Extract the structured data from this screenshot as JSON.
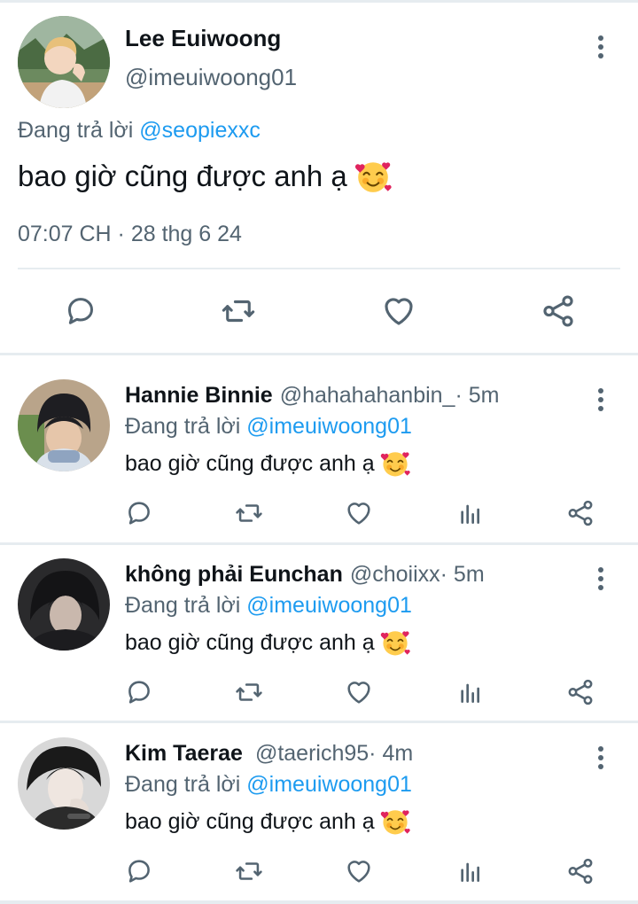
{
  "main_tweet": {
    "author_name": "Lee Euiwoong",
    "author_handle": "@imeuiwoong01",
    "reply_prefix": "Đang trả lời",
    "reply_to": "@seopiexxc",
    "text": "bao giờ cũng được anh ạ",
    "emoji": "smiling-face-with-hearts",
    "timestamp": "07:07 CH · 28 thg 6 24",
    "actions": [
      "reply-icon",
      "retweet-icon",
      "like-icon",
      "share-icon"
    ]
  },
  "replies": [
    {
      "author_name": "Hannie Binnie",
      "author_handle": "@hahahahanbin_",
      "time": " · 5m",
      "reply_prefix": "Đang trả lời",
      "reply_to": "@imeuiwoong01",
      "text": "bao giờ cũng được anh ạ",
      "emoji": "smiling-face-with-hearts"
    },
    {
      "author_name": "không phải Eunchan",
      "author_handle": "@choiixx",
      "time": " · 5m",
      "reply_prefix": "Đang trả lời",
      "reply_to": "@imeuiwoong01",
      "text": "bao giờ cũng được anh ạ",
      "emoji": "smiling-face-with-hearts"
    },
    {
      "author_name": "Kim Taerae",
      "author_handle": "@taerich95",
      "time": " · 4m",
      "reply_prefix": "Đang trả lời",
      "reply_to": "@imeuiwoong01",
      "text": "bao giờ cũng được anh ạ",
      "emoji": "smiling-face-with-hearts"
    }
  ],
  "reply_actions": [
    "reply-icon",
    "retweet-icon",
    "like-icon",
    "analytics-icon",
    "share-icon"
  ],
  "colors": {
    "text_primary": "#0f1419",
    "text_secondary": "#536471",
    "link": "#1d9bf0",
    "divider": "#e6ecf0"
  }
}
